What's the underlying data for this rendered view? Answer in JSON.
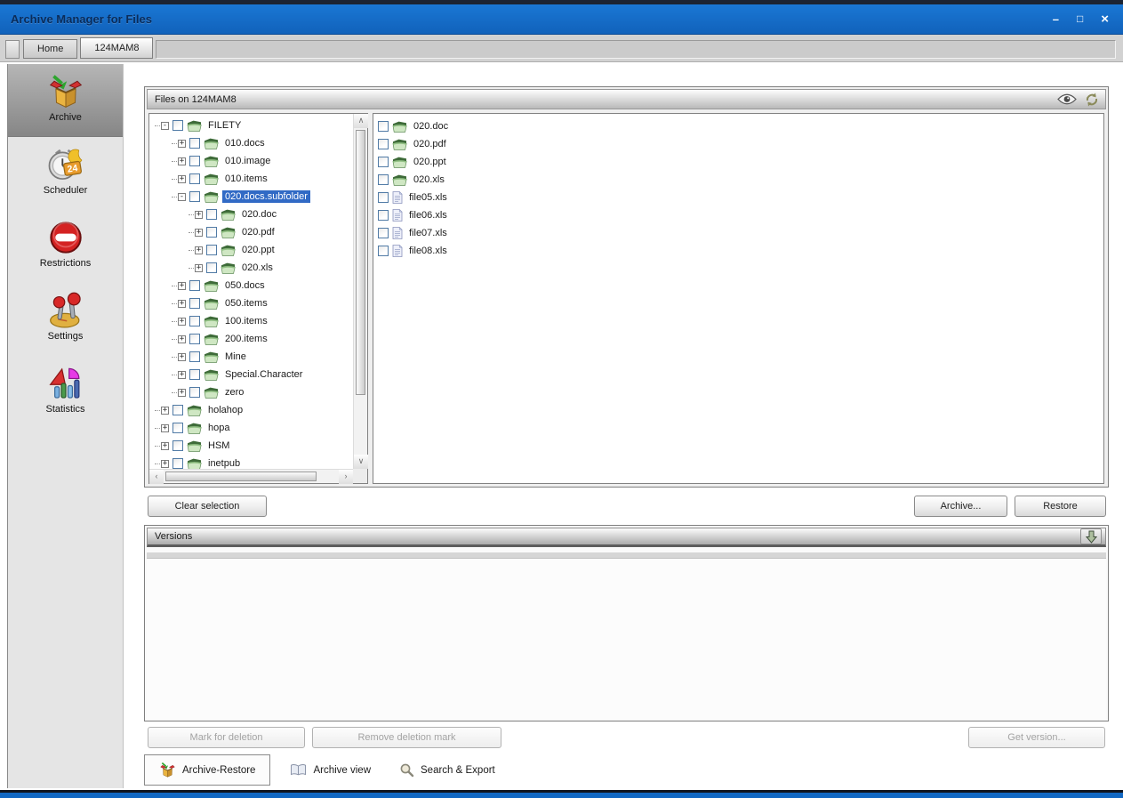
{
  "window": {
    "title": "Archive Manager for Files",
    "controls": [
      {
        "name": "minimize",
        "glyph": "–"
      },
      {
        "name": "maximize",
        "glyph": "□"
      },
      {
        "name": "close",
        "glyph": "×"
      }
    ]
  },
  "top_tabs": [
    {
      "label": "Home",
      "selected": false
    },
    {
      "label": "124MAM8",
      "selected": true
    }
  ],
  "sidebar": {
    "items": [
      {
        "label": "Archive",
        "icon": "archive-icon",
        "selected": true
      },
      {
        "label": "Scheduler",
        "icon": "scheduler-icon",
        "selected": false
      },
      {
        "label": "Restrictions",
        "icon": "restrictions-icon",
        "selected": false
      },
      {
        "label": "Settings",
        "icon": "settings-icon",
        "selected": false
      },
      {
        "label": "Statistics",
        "icon": "statistics-icon",
        "selected": false
      }
    ]
  },
  "files_panel": {
    "title": "Files on 124MAM8",
    "header_icons": [
      "eye-icon",
      "refresh-icon"
    ],
    "tree": [
      {
        "label": "FILETY",
        "level": 0,
        "expander": "minus",
        "selected": false
      },
      {
        "label": "010.docs",
        "level": 1,
        "expander": "plus",
        "selected": false
      },
      {
        "label": "010.image",
        "level": 1,
        "expander": "plus",
        "selected": false
      },
      {
        "label": "010.items",
        "level": 1,
        "expander": "plus",
        "selected": false
      },
      {
        "label": "020.docs.subfolder",
        "level": 1,
        "expander": "minus",
        "selected": true
      },
      {
        "label": "020.doc",
        "level": 2,
        "expander": "plus",
        "selected": false
      },
      {
        "label": "020.pdf",
        "level": 2,
        "expander": "plus",
        "selected": false
      },
      {
        "label": "020.ppt",
        "level": 2,
        "expander": "plus",
        "selected": false
      },
      {
        "label": "020.xls",
        "level": 2,
        "expander": "plus",
        "selected": false
      },
      {
        "label": "050.docs",
        "level": 1,
        "expander": "plus",
        "selected": false
      },
      {
        "label": "050.items",
        "level": 1,
        "expander": "plus",
        "selected": false
      },
      {
        "label": "100.items",
        "level": 1,
        "expander": "plus",
        "selected": false
      },
      {
        "label": "200.items",
        "level": 1,
        "expander": "plus",
        "selected": false
      },
      {
        "label": "Mine",
        "level": 1,
        "expander": "plus",
        "selected": false
      },
      {
        "label": "Special.Character",
        "level": 1,
        "expander": "plus",
        "selected": false
      },
      {
        "label": "zero",
        "level": 1,
        "expander": "plus",
        "selected": false
      },
      {
        "label": "holahop",
        "level": 0,
        "expander": "plus",
        "selected": false
      },
      {
        "label": "hopa",
        "level": 0,
        "expander": "plus",
        "selected": false
      },
      {
        "label": "HSM",
        "level": 0,
        "expander": "plus",
        "selected": false
      },
      {
        "label": "inetpub",
        "level": 0,
        "expander": "plus",
        "selected": false
      }
    ],
    "files": [
      {
        "name": "020.doc",
        "icon": "folder-icon"
      },
      {
        "name": "020.pdf",
        "icon": "folder-icon"
      },
      {
        "name": "020.ppt",
        "icon": "folder-icon"
      },
      {
        "name": "020.xls",
        "icon": "folder-icon"
      },
      {
        "name": "file05.xls",
        "icon": "file-icon"
      },
      {
        "name": "file06.xls",
        "icon": "file-icon"
      },
      {
        "name": "file07.xls",
        "icon": "file-icon"
      },
      {
        "name": "file08.xls",
        "icon": "file-icon"
      }
    ],
    "buttons": {
      "clear_selection": "Clear selection",
      "archive": "Archive...",
      "restore": "Restore"
    }
  },
  "versions_panel": {
    "title": "Versions",
    "collapse_icon": "down-arrow-icon",
    "rows": [],
    "buttons": [
      {
        "label": "Mark for deletion",
        "enabled": false
      },
      {
        "label": "Remove deletion mark",
        "enabled": false
      },
      {
        "label": "Get version...",
        "enabled": false
      }
    ]
  },
  "bottom_tabs": [
    {
      "label": "Archive-Restore",
      "icon": "archive-icon",
      "selected": true
    },
    {
      "label": "Archive view",
      "icon": "book-icon",
      "selected": false
    },
    {
      "label": "Search & Export",
      "icon": "search-icon",
      "selected": false
    }
  ],
  "colors": {
    "titlebar_blue": "#1268c3",
    "selection_blue": "#316ac5",
    "chrome_dark": "#1c2433"
  }
}
